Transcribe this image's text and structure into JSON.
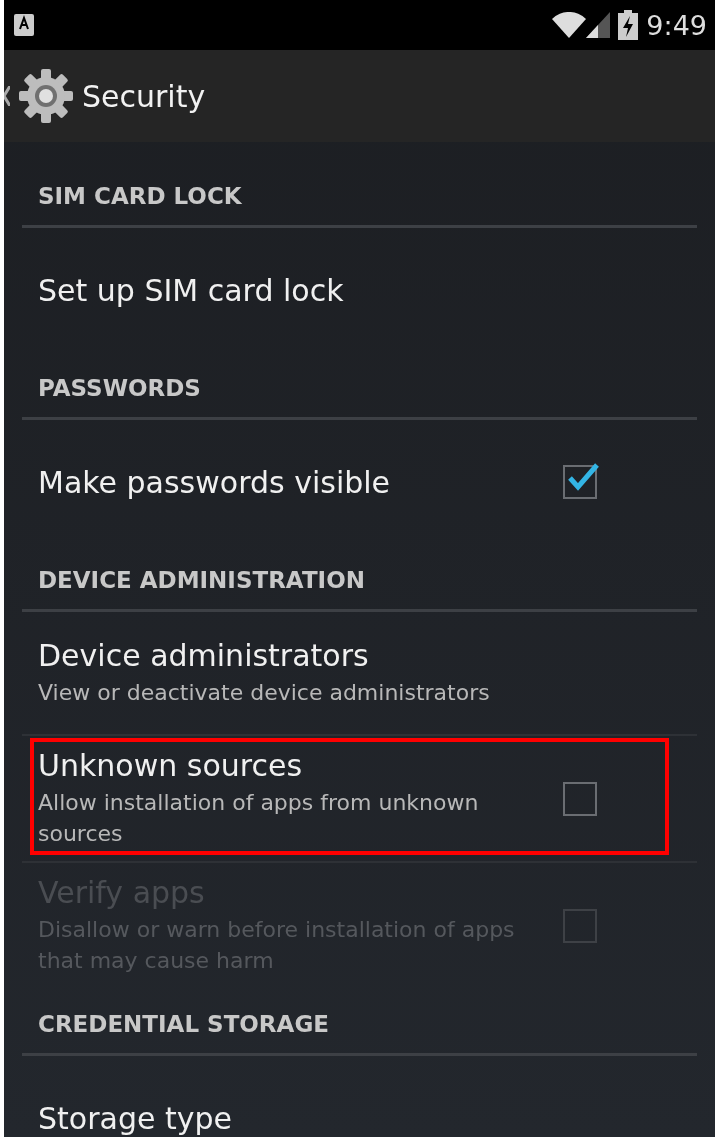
{
  "status_bar": {
    "time": "9:49"
  },
  "action_bar": {
    "title": "Security"
  },
  "list": [
    {
      "kind": "category",
      "title": "SIM CARD LOCK"
    },
    {
      "kind": "plain",
      "title": "Set up SIM card lock",
      "disabled": false,
      "highlighted": false
    },
    {
      "kind": "category",
      "title": "PASSWORDS"
    },
    {
      "kind": "checkbox",
      "title": "Make passwords visible",
      "checked": true,
      "disabled": false,
      "highlighted": false
    },
    {
      "kind": "category",
      "title": "DEVICE ADMINISTRATION"
    },
    {
      "kind": "plain",
      "title": "Device administrators",
      "summary": "View or deactivate device administrators",
      "disabled": false,
      "highlighted": false
    },
    {
      "kind": "checkbox",
      "title": "Unknown sources",
      "summary": "Allow installation of apps from unknown sources",
      "checked": false,
      "disabled": false,
      "highlighted": true
    },
    {
      "kind": "checkbox",
      "title": "Verify apps",
      "summary": "Disallow or warn before installation of apps that may cause harm",
      "checked": false,
      "disabled": true,
      "highlighted": false
    },
    {
      "kind": "category",
      "title": "CREDENTIAL STORAGE"
    },
    {
      "kind": "plain",
      "title": "Storage type",
      "disabled": false,
      "highlighted": false
    }
  ]
}
